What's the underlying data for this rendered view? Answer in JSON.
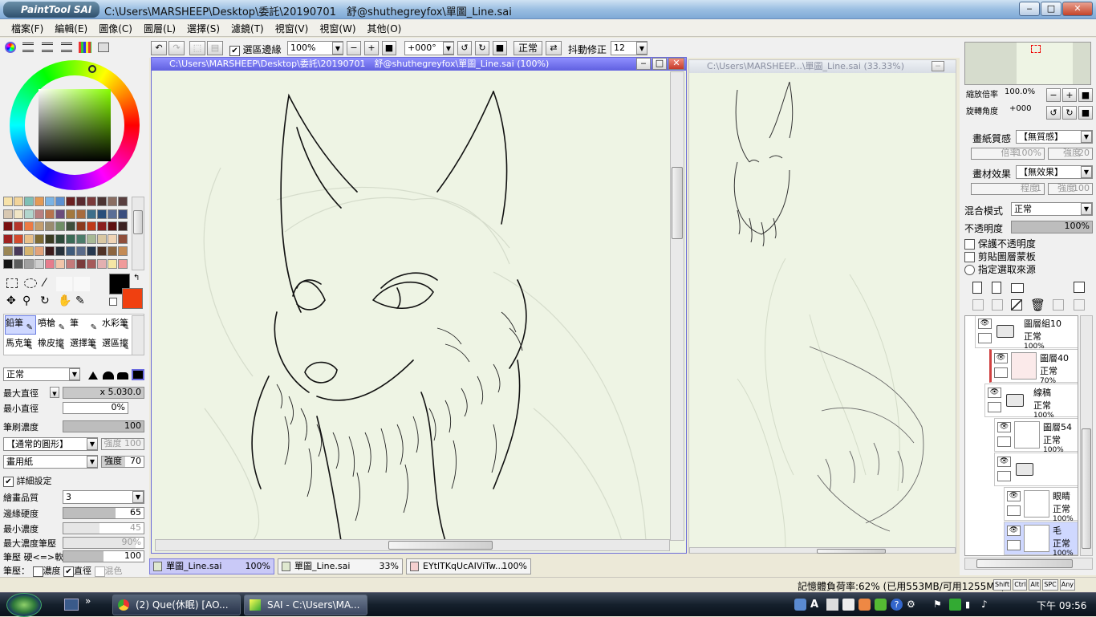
{
  "window": {
    "app_logo": "PaintTool SAI",
    "title": "C:\\Users\\MARSHEEP\\Desktop\\委託\\20190701　舒@shuthegreyfox\\單圖_Line.sai",
    "min_label": "‒",
    "max_label": "□",
    "close_label": "✕"
  },
  "menu": [
    "檔案(F)",
    "編輯(E)",
    "圖像(C)",
    "圖層(L)",
    "選擇(S)",
    "濾鏡(T)",
    "視窗(V)",
    "視窗(W)",
    "其他(O)"
  ],
  "toolbar": {
    "selection_edge_label": "選區邊緣",
    "selection_edge_checked": true,
    "zoom_value": "100%",
    "rotation_value": "+000°",
    "mode_label": "正常",
    "stabilizer_label": "抖動修正",
    "stabilizer_value": "12"
  },
  "left_panel": {
    "tools_row1": [
      "鉛筆",
      "噴槍",
      "筆",
      "水彩筆"
    ],
    "tools_row2": [
      "馬克筆",
      "橡皮擦",
      "選擇筆",
      "選區擦"
    ],
    "blend_mode": "正常",
    "max_diameter_label": "最大直徑",
    "max_diameter_mult": "x 5.0",
    "max_diameter_value": "30.0",
    "min_diameter_label": "最小直徑",
    "min_diameter_value": "0%",
    "brush_density_label": "筆刷濃度",
    "brush_density_value": "100",
    "shape_label": "【通常的圓形】",
    "shape_strength": "強度 100",
    "texture_label": "畫用紙",
    "texture_strength": "強度",
    "texture_strength_value": "70",
    "detail_label": "詳細設定",
    "quality_label": "繪畫品質",
    "quality_value": "3",
    "edge_hardness_label": "邊緣硬度",
    "edge_hardness_value": "65",
    "min_density_label": "最小濃度",
    "min_density_value": "45",
    "max_density_pressure_label": "最大濃度筆壓",
    "max_density_pressure_value": "90%",
    "pressure_hardness_label": "筆壓 硬<=>軟",
    "pressure_hardness_value": "100",
    "pressure_label": "筆壓：",
    "pressure_density": "濃度",
    "pressure_diameter": "直徑",
    "pressure_blend": "混色",
    "swatches": [
      "#f7e2a9",
      "#f2d49a",
      "#7fbfb5",
      "#e39a55",
      "#7ab3e3",
      "#5b8fd0",
      "#6b2021",
      "#592a2f",
      "#7b3a3a",
      "#4c3432",
      "#8a6e62",
      "#593f3f",
      "#d8c8b2",
      "#f1e6c5",
      "#b2d5cd",
      "#b98080",
      "#b8734d",
      "#6b4c7c",
      "#a3783e",
      "#a76b3e",
      "#3e6e8a",
      "#294e7a",
      "#5a6e96",
      "#3a4e7e",
      "#7a1010",
      "#b6352a",
      "#ed7a44",
      "#c49e6e",
      "#9a8c6f",
      "#6f8e66",
      "#3e4f3b",
      "#8b3a1e",
      "#bf3a1a",
      "#8b1f1f",
      "#5e0f0f",
      "#3d2222",
      "#a02020",
      "#d44a2d",
      "#e9c08a",
      "#7e6b33",
      "#3a3b22",
      "#2d4a3a",
      "#3b6b56",
      "#4c7c6a",
      "#a7b995",
      "#d9c7a2",
      "#f0d4b5",
      "#8f4e3a",
      "#9b8655",
      "#4a3a5a",
      "#d6b36e",
      "#e3a37a",
      "#3d1c1c",
      "#26313b",
      "#3f5b7b",
      "#5a6b8a",
      "#26384f",
      "#4f3226",
      "#8c6540",
      "#c48b55",
      "#141414",
      "#5b5c5c",
      "#a0a0a0",
      "#cfcfcf",
      "#e67c8c",
      "#f2c5a9",
      "#c47a7a",
      "#7a3b3b",
      "#a55a5a",
      "#e3b0b0",
      "#f5e6a5",
      "#ef9a9a"
    ]
  },
  "doc1": {
    "title": "C:\\Users\\MARSHEEP\\Desktop\\委託\\20190701　舒@shuthegreyfox\\單圖_Line.sai (100%)"
  },
  "doc2": {
    "title": "C:\\Users\\MARSHEEP...\\單圖_Line.sai (33.33%)"
  },
  "tabs": [
    {
      "name": "單圖_Line.sai",
      "zoom": "100%"
    },
    {
      "name": "單圖_Line.sai",
      "zoom": "33%"
    },
    {
      "name": "EYtlTKqUcAIViTw...",
      "zoom": "100%"
    }
  ],
  "right_panel": {
    "zoom_label": "縮放倍率",
    "zoom_value": "100.0%",
    "rotate_label": "旋轉角度",
    "rotate_value": "+000",
    "paper_texture_label": "畫紙質感",
    "paper_texture_value": "【無質感】",
    "paper_scale_label": "倍率",
    "paper_scale_value": "100%",
    "paper_strength_label": "強度",
    "paper_strength_value": "20",
    "media_effect_label": "畫材效果",
    "media_effect_value": "【無效果】",
    "media_degree_label": "程度",
    "media_degree_value": "1",
    "media_strength_label": "強度",
    "media_strength_value": "100",
    "blend_mode_label": "混合模式",
    "blend_mode_value": "正常",
    "opacity_label": "不透明度",
    "opacity_value": "100%",
    "preserve_opacity": "保護不透明度",
    "clipping": "剪貼圖層蒙板",
    "sampling_source": "指定選取來源"
  },
  "layers": [
    {
      "name": "圖層組10",
      "mode": "正常",
      "opacity": "100%"
    },
    {
      "name": "圖層40",
      "mode": "正常",
      "opacity": "70%"
    },
    {
      "name": "線稿",
      "mode": "正常",
      "opacity": "100%"
    },
    {
      "name": "圖層54",
      "mode": "正常",
      "opacity": "100%"
    },
    {
      "name": "",
      "mode": "",
      "opacity": ""
    },
    {
      "name": "眼睛",
      "mode": "正常",
      "opacity": "100%"
    },
    {
      "name": "毛",
      "mode": "正常",
      "opacity": "100%"
    }
  ],
  "status": {
    "memory": "記憶體負荷率:62% (已用553MB/可用1255MB)",
    "keys": [
      "Shift",
      "Ctrl",
      "Alt",
      "SPC",
      "Any"
    ]
  },
  "taskbar": {
    "chrome_task": "(2) Que(休眠) [AO...",
    "sai_task": "SAI - C:\\Users\\MA...",
    "clock": "下午 09:56"
  }
}
